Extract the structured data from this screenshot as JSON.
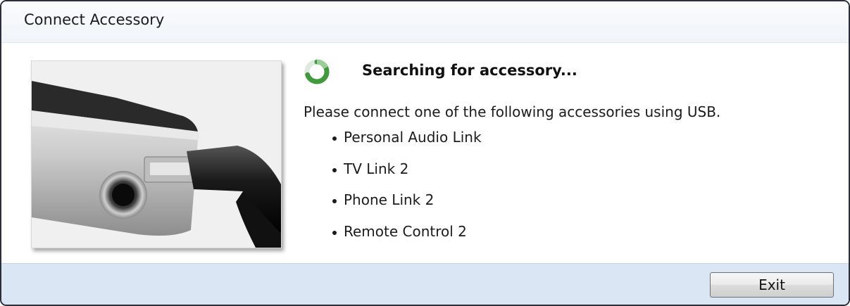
{
  "window": {
    "title": "Connect Accessory"
  },
  "illustration": {
    "icon": "usb-device-illustration"
  },
  "status": {
    "icon": "spinner-icon",
    "heading": "Searching for accessory...",
    "accent_color": "#4fa64a"
  },
  "instruction": "Please connect one of the following accessories using USB.",
  "accessories": [
    {
      "label": "Personal Audio Link"
    },
    {
      "label": "TV Link 2"
    },
    {
      "label": "Phone Link 2"
    },
    {
      "label": "Remote Control 2"
    }
  ],
  "footer": {
    "exit_label": "Exit"
  }
}
